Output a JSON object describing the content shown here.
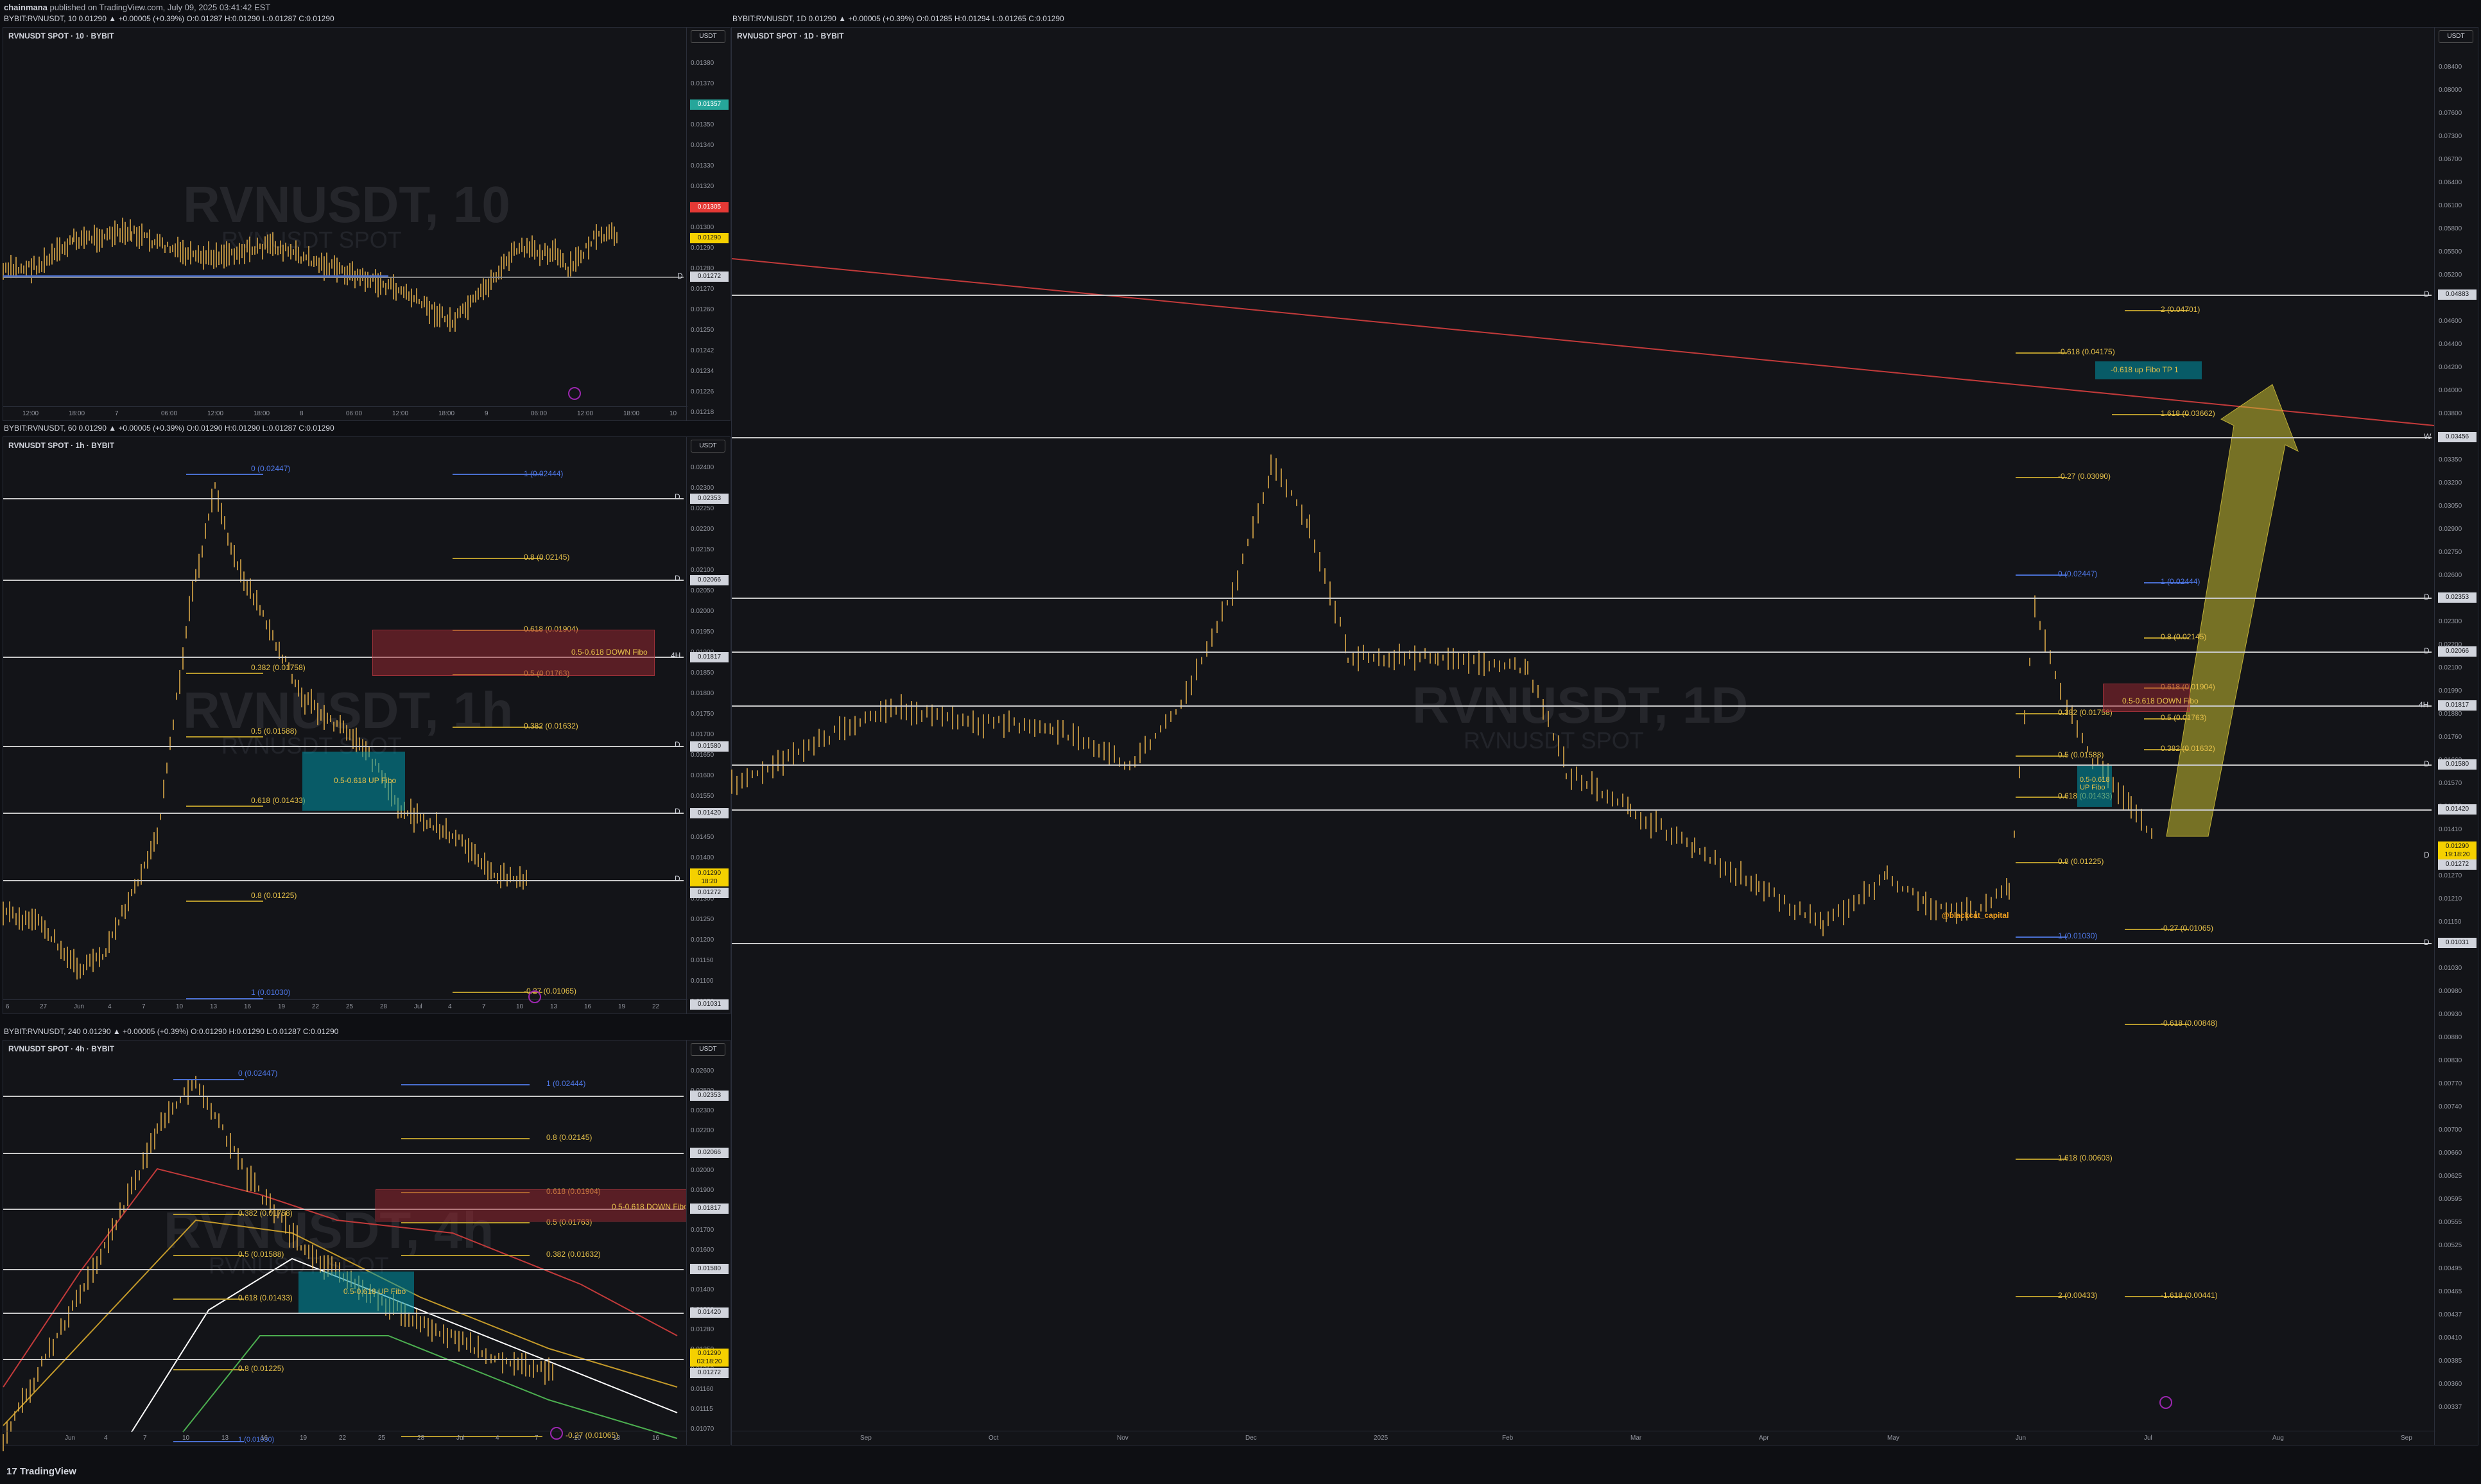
{
  "header": {
    "user": "chainmana",
    "published": "published on TradingView.com, July 09, 2025 03:41:42 EST"
  },
  "panes": {
    "p10": {
      "legend": "BYBIT:RVNUSDT, 10  0.01290 ▲ +0.00005 (+0.39%)  O:0.01287 H:0.01290 L:0.01287 C:0.01290",
      "title": "RVNUSDT SPOT · 10 · BYBIT",
      "wm": "RVNUSDT, 10",
      "wm2": "RVNUSDT SPOT",
      "unit": "USDT",
      "ticks": [
        "0.01380",
        "0.01370",
        "0.01360",
        "0.01350",
        "0.01340",
        "0.01330",
        "0.01320",
        "0.01310",
        "0.01300",
        "0.01290",
        "0.01280",
        "0.01270",
        "0.01260",
        "0.01250",
        "0.01242",
        "0.01234",
        "0.01226",
        "0.01218"
      ],
      "xticks": [
        "12:00",
        "18:00",
        "7",
        "06:00",
        "12:00",
        "18:00",
        "8",
        "06:00",
        "12:00",
        "18:00",
        "9",
        "06:00",
        "12:00",
        "18:00",
        "10"
      ],
      "prices": {
        "green": "0.01357",
        "red": "0.01305",
        "yellow": "0.01290",
        "level": "0.01272"
      },
      "dlabel": "D"
    },
    "p1h": {
      "legend": "BYBIT:RVNUSDT, 60  0.01290 ▲ +0.00005 (+0.39%)  O:0.01290 H:0.01290 L:0.01287 C:0.01290",
      "title": "RVNUSDT SPOT · 1h · BYBIT",
      "wm": "RVNUSDT, 1h",
      "wm2": "RVNUSDT SPOT",
      "unit": "USDT",
      "ticks": [
        "0.02400",
        "0.02300",
        "0.02250",
        "0.02200",
        "0.02150",
        "0.02100",
        "0.02050",
        "0.02000",
        "0.01950",
        "0.01900",
        "0.01850",
        "0.01800",
        "0.01750",
        "0.01700",
        "0.01650",
        "0.01600",
        "0.01550",
        "0.01500",
        "0.01450",
        "0.01400",
        "0.01350",
        "0.01300",
        "0.01250",
        "0.01200",
        "0.01150",
        "0.01100",
        "0.01050"
      ],
      "xticks": [
        "6",
        "27",
        "Jun",
        "4",
        "7",
        "10",
        "13",
        "16",
        "19",
        "22",
        "25",
        "28",
        "Jul",
        "4",
        "7",
        "10",
        "13",
        "16",
        "19",
        "22"
      ],
      "fibs_down": [
        {
          "t": "0 (0.02447)"
        },
        {
          "t": "0.382 (0.01758)"
        },
        {
          "t": "0.5 (0.01588)"
        },
        {
          "t": "0.618 (0.01433)"
        },
        {
          "t": "0.8 (0.01225)"
        },
        {
          "t": "1 (0.01030)"
        }
      ],
      "fibs_up": [
        {
          "t": "1 (0.02444)"
        },
        {
          "t": "0.8 (0.02145)"
        },
        {
          "t": "0.618 (0.01904)"
        },
        {
          "t": "0.5 (0.01763)"
        },
        {
          "t": "0.382 (0.01632)"
        },
        {
          "t": "-0.27 (0.01065)"
        }
      ],
      "box_red": "0.5-0.618 DOWN Fibo",
      "box_teal": "0.5-0.618 UP Fibo",
      "prices": [
        "0.02353",
        "0.02066",
        "0.01817",
        "0.01580",
        "0.01420",
        "0.01290",
        "0.01272",
        "0.01031"
      ],
      "yellow_time": "18:20",
      "levels": [
        "D",
        "D",
        "4H",
        "D",
        "D",
        "D"
      ]
    },
    "p4h": {
      "legend": "BYBIT:RVNUSDT, 240  0.01290 ▲ +0.00005 (+0.39%)  O:0.01290 H:0.01290 L:0.01287 C:0.01290",
      "title": "RVNUSDT SPOT · 4h · BYBIT",
      "wm": "RVNUSDT, 4h",
      "wm2": "RVNUSDT SPOT",
      "unit": "USDT",
      "ticks": [
        "0.02600",
        "0.02500",
        "0.02300",
        "0.02200",
        "0.02100",
        "0.02000",
        "0.01900",
        "0.01800",
        "0.01700",
        "0.01600",
        "0.01500",
        "0.01400",
        "0.01300",
        "0.01280",
        "0.01250",
        "0.01210",
        "0.01160",
        "0.01115",
        "0.01070"
      ],
      "xticks": [
        "Jun",
        "4",
        "7",
        "10",
        "13",
        "16",
        "19",
        "22",
        "25",
        "28",
        "Jul",
        "4",
        "7",
        "10",
        "13",
        "16"
      ],
      "fibs_down": [
        {
          "t": "0 (0.02447)"
        },
        {
          "t": "0.382 (0.01758)"
        },
        {
          "t": "0.5 (0.01588)"
        },
        {
          "t": "0.618 (0.01433)"
        },
        {
          "t": "0.8 (0.01225)"
        },
        {
          "t": "1 (0.01030)"
        }
      ],
      "fibs_up": [
        {
          "t": "1 (0.02444)"
        },
        {
          "t": "0.8 (0.02145)"
        },
        {
          "t": "0.618 (0.01904)"
        },
        {
          "t": "0.5 (0.01763)"
        },
        {
          "t": "0.382 (0.01632)"
        },
        {
          "t": "-0.27 (0.01065)"
        }
      ],
      "box_red": "0.5-0.618 DOWN Fibo",
      "box_teal": "0.5-0.618 UP Fibo",
      "prices": [
        "0.02353",
        "0.02066",
        "0.01817",
        "0.01580",
        "0.01420",
        "0.01290",
        "0.01272"
      ],
      "yellow_time": "03:18:20"
    },
    "p1d": {
      "legend": "BYBIT:RVNUSDT, 1D  0.01290 ▲ +0.00005 (+0.39%)  O:0.01285 H:0.01294 L:0.01265 C:0.01290",
      "title": "RVNUSDT SPOT · 1D · BYBIT",
      "wm": "RVNUSDT, 1D",
      "wm2": "RVNUSDT SPOT",
      "unit": "USDT",
      "ticks": [
        "0.08400",
        "0.08000",
        "0.07600",
        "0.07300",
        "0.06700",
        "0.06400",
        "0.06100",
        "0.05800",
        "0.05500",
        "0.05200",
        "0.04900",
        "0.04600",
        "0.04400",
        "0.04200",
        "0.04000",
        "0.03800",
        "0.03600",
        "0.03350",
        "0.03200",
        "0.03050",
        "0.02900",
        "0.02750",
        "0.02600",
        "0.02450",
        "0.02300",
        "0.02200",
        "0.02100",
        "0.01990",
        "0.01880",
        "0.01760",
        "0.01660",
        "0.01570",
        "0.01490",
        "0.01410",
        "0.01340",
        "0.01270",
        "0.01210",
        "0.01150",
        "0.01090",
        "0.01030",
        "0.00980",
        "0.00930",
        "0.00880",
        "0.00830",
        "0.00770",
        "0.00740",
        "0.00700",
        "0.00660",
        "0.00625",
        "0.00595",
        "0.00555",
        "0.00525",
        "0.00495",
        "0.00465",
        "0.00437",
        "0.00410",
        "0.00385",
        "0.00360",
        "0.00337"
      ],
      "xticks": [
        "Sep",
        "Oct",
        "Nov",
        "Dec",
        "2025",
        "Feb",
        "Mar",
        "Apr",
        "May",
        "Jun",
        "Jul",
        "Aug",
        "Sep"
      ],
      "fib_ext": [
        {
          "t": "2 (0.04701)"
        },
        {
          "t": "1.618 (0.03662)"
        },
        {
          "t": "-0.27 (0.01065)"
        },
        {
          "t": "-0.618 (0.00848)"
        },
        {
          "t": "-1.618 (0.00441)"
        }
      ],
      "fib_left": [
        {
          "t": "-0.618 (0.04175)"
        },
        {
          "t": "-0.27 (0.03090)"
        },
        {
          "t": "0 (0.02447)"
        },
        {
          "t": "0.382 (0.01758)"
        },
        {
          "t": "0.5 (0.01588)"
        },
        {
          "t": "0.618 (0.01433)"
        },
        {
          "t": "0.8 (0.01225)"
        },
        {
          "t": "1 (0.01030)"
        },
        {
          "t": "1.618 (0.00603)"
        },
        {
          "t": "2 (0.00433)"
        }
      ],
      "fib_right": [
        {
          "t": "1 (0.02444)"
        },
        {
          "t": "0.8 (0.02145)"
        },
        {
          "t": "0.618 (0.01904)"
        },
        {
          "t": "0.5 (0.01763)"
        },
        {
          "t": "0.382 (0.01632)"
        }
      ],
      "tp_box": "-0.618 up Fibo TP 1",
      "box_red": "0.5-0.618 DOWN Fibo",
      "box_teal": "0.5-0.618 UP Fibo",
      "author": "@blackcat_capital",
      "prices": {
        "p1": "0.04883",
        "p2": "0.03456",
        "p3": "0.02353",
        "p4": "0.02066",
        "p5": "0.01817",
        "p6": "0.01580",
        "p7": "0.01420",
        "p8": "0.01290",
        "p9": "0.01272",
        "p10": "0.01031"
      },
      "yellow_time": "19:18:20",
      "levels": [
        "D",
        "W",
        "D",
        "D",
        "4H",
        "D",
        "D",
        "D"
      ]
    }
  },
  "footer": "TradingView"
}
